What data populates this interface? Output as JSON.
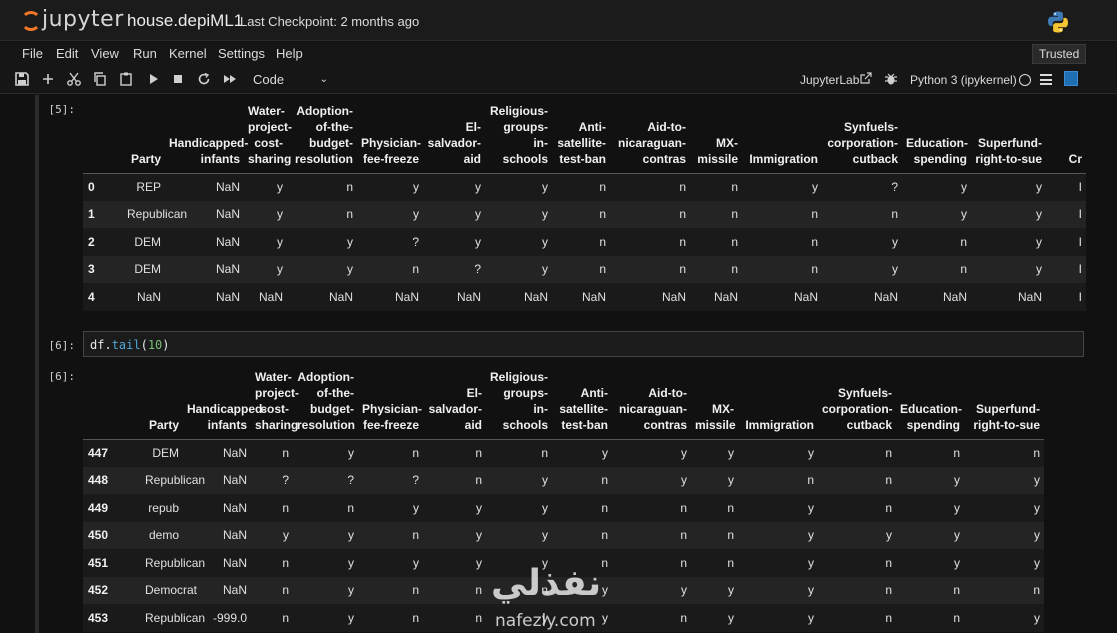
{
  "app": {
    "logo_text": "jupyter",
    "notebook_title": "house.depiML1",
    "checkpoint": "Last Checkpoint: 2 months ago"
  },
  "menu": [
    "File",
    "Edit",
    "View",
    "Run",
    "Kernel",
    "Settings",
    "Help"
  ],
  "trusted": "Trusted",
  "toolbar": {
    "cell_type": "Code",
    "jupyterlab_label": "JupyterLab",
    "kernel_name": "Python 3 (ipykernel)"
  },
  "columns": [
    "Party",
    "Handicapped-infants",
    "Water-project-cost-sharing",
    "Adoption-of-the-budget-resolution",
    "Physician-fee-freeze",
    "El-salvador-aid",
    "Religious-groups-in-schools",
    "Anti-satellite-test-ban",
    "Aid-to-nicaraguan-contras",
    "MX-missile",
    "Immigration",
    "Synfuels-corporation-cutback",
    "Education-spending",
    "Superfund-right-to-sue",
    "Cr"
  ],
  "cell5": {
    "prompt": "[5]:",
    "rows": [
      {
        "index": "0",
        "values": [
          "REP",
          "NaN",
          "y",
          "n",
          "y",
          "y",
          "y",
          "n",
          "n",
          "n",
          "y",
          "?",
          "y",
          "y",
          "I"
        ]
      },
      {
        "index": "1",
        "values": [
          "Republican",
          "NaN",
          "y",
          "n",
          "y",
          "y",
          "y",
          "n",
          "n",
          "n",
          "n",
          "n",
          "y",
          "y",
          "I"
        ]
      },
      {
        "index": "2",
        "values": [
          "DEM",
          "NaN",
          "y",
          "y",
          "?",
          "y",
          "y",
          "n",
          "n",
          "n",
          "n",
          "y",
          "n",
          "y",
          "I"
        ]
      },
      {
        "index": "3",
        "values": [
          "DEM",
          "NaN",
          "y",
          "y",
          "n",
          "?",
          "y",
          "n",
          "n",
          "n",
          "n",
          "y",
          "n",
          "y",
          "I"
        ]
      },
      {
        "index": "4",
        "values": [
          "NaN",
          "NaN",
          "NaN",
          "NaN",
          "NaN",
          "NaN",
          "NaN",
          "NaN",
          "NaN",
          "NaN",
          "NaN",
          "NaN",
          "NaN",
          "NaN",
          "I"
        ]
      }
    ]
  },
  "cell6": {
    "in_prompt": "[6]:",
    "code_var": "df.",
    "code_method": "tail",
    "code_open": "(",
    "code_arg": "10",
    "code_close": ")",
    "out_prompt": "[6]:",
    "rows": [
      {
        "index": "447",
        "values": [
          "DEM",
          "NaN",
          "n",
          "y",
          "n",
          "n",
          "n",
          "y",
          "y",
          "y",
          "y",
          "n",
          "n",
          "n"
        ]
      },
      {
        "index": "448",
        "values": [
          "Republican",
          "NaN",
          "?",
          "?",
          "?",
          "n",
          "y",
          "n",
          "y",
          "y",
          "n",
          "n",
          "y",
          "y"
        ]
      },
      {
        "index": "449",
        "values": [
          "repub",
          "NaN",
          "n",
          "n",
          "y",
          "y",
          "y",
          "n",
          "n",
          "n",
          "y",
          "n",
          "y",
          "y"
        ]
      },
      {
        "index": "450",
        "values": [
          "demo",
          "NaN",
          "y",
          "y",
          "n",
          "y",
          "y",
          "n",
          "n",
          "n",
          "y",
          "y",
          "y",
          "y"
        ]
      },
      {
        "index": "451",
        "values": [
          "Republican",
          "NaN",
          "n",
          "y",
          "y",
          "y",
          "y",
          "n",
          "n",
          "n",
          "y",
          "n",
          "y",
          "y"
        ]
      },
      {
        "index": "452",
        "values": [
          "Democrat",
          "NaN",
          "n",
          "y",
          "n",
          "n",
          "n",
          "y",
          "y",
          "y",
          "y",
          "n",
          "n",
          "n"
        ]
      },
      {
        "index": "453",
        "values": [
          "Republican",
          "-999.0",
          "n",
          "y",
          "n",
          "n",
          "y",
          "y",
          "n",
          "y",
          "y",
          "n",
          "n",
          "y"
        ]
      }
    ]
  },
  "watermark": {
    "arabic": "نفذلي",
    "latin": "nafezly.com"
  }
}
